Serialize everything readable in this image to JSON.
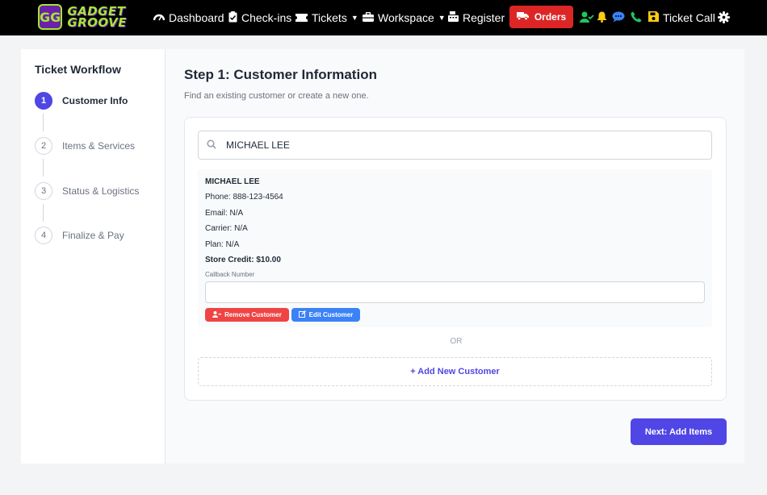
{
  "nav": {
    "logo_mark": "GG",
    "logo_line1": "GADGET",
    "logo_line2": "GROOVE",
    "items": [
      {
        "label": "Dashboard",
        "icon": "gauge-icon"
      },
      {
        "label": "Check-ins",
        "icon": "clipboard-check-icon"
      },
      {
        "label": "Tickets",
        "icon": "ticket-icon"
      },
      {
        "label": "Workspace",
        "icon": "toolbox-icon"
      },
      {
        "label": "Register",
        "icon": "cash-register-icon"
      }
    ],
    "orders_label": "Orders",
    "ticket_call_label": "Ticket Call",
    "colors": {
      "bar": "#000000",
      "orders": "#dc2626",
      "accent_green": "#22c55e",
      "bell": "#facc15",
      "chat": "#3b82f6"
    }
  },
  "sidebar": {
    "title": "Ticket Workflow",
    "steps": [
      {
        "num": "1",
        "label": "Customer Info",
        "active": true
      },
      {
        "num": "2",
        "label": "Items & Services",
        "active": false
      },
      {
        "num": "3",
        "label": "Status & Logistics",
        "active": false
      },
      {
        "num": "4",
        "label": "Finalize & Pay",
        "active": false
      }
    ]
  },
  "main": {
    "title": "Step 1: Customer Information",
    "subtitle": "Find an existing customer or create a new one.",
    "search_value": "MICHAEL LEE",
    "customer": {
      "name": "MICHAEL LEE",
      "phone": "Phone: 888-123-4564",
      "email": "Email: N/A",
      "carrier": "Carrier: N/A",
      "plan": "Plan: N/A",
      "store_credit": "Store Credit: $10.00",
      "callback_label": "Callback Number",
      "callback_value": "",
      "remove_label": "Remove Customer",
      "edit_label": "Edit Customer"
    },
    "or_text": "OR",
    "add_new_label": "+ Add New Customer",
    "next_label": "Next: Add Items",
    "accent": "#4f46e5"
  }
}
